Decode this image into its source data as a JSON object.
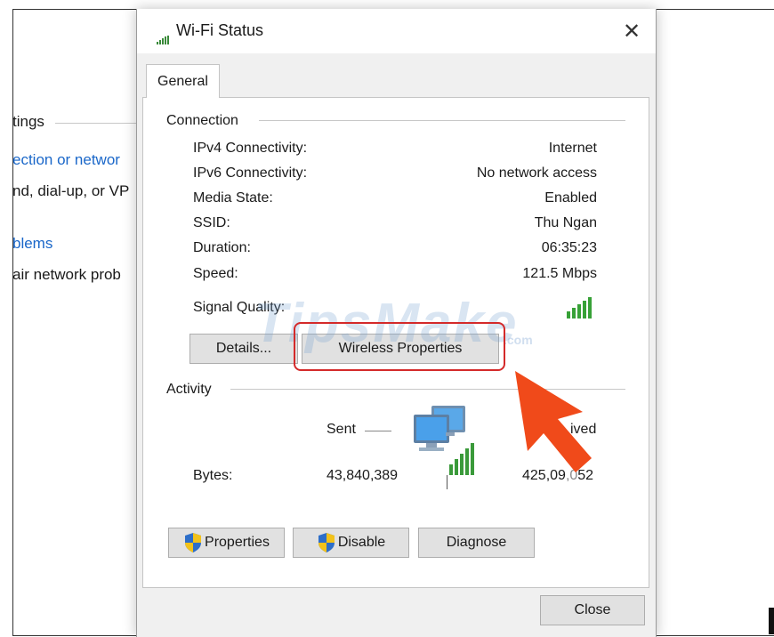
{
  "background": {
    "settings_fragment": "tings",
    "link_fragment": "ection or networ",
    "text_fragment": "nd, dial-up, or VP",
    "link2_fragment": "blems",
    "text2_fragment": "air network prob"
  },
  "dialog": {
    "title": "Wi-Fi Status",
    "close_glyph": "✕",
    "tab": "General",
    "connection": {
      "header": "Connection",
      "rows": [
        {
          "label": "IPv4 Connectivity:",
          "value": "Internet"
        },
        {
          "label": "IPv6 Connectivity:",
          "value": "No network access"
        },
        {
          "label": "Media State:",
          "value": "Enabled"
        },
        {
          "label": "SSID:",
          "value": "Thu Ngan"
        },
        {
          "label": "Duration:",
          "value": "06:35:23"
        },
        {
          "label": "Speed:",
          "value": "121.5 Mbps"
        }
      ],
      "signal_label": "Signal Quality:",
      "signal_bars": 5,
      "details_button": "Details...",
      "wireless_button": "Wireless Properties"
    },
    "activity": {
      "header": "Activity",
      "sent_label": "Sent",
      "received_label": "ived",
      "bytes_label": "Bytes:",
      "bytes_sent": "43,840,389",
      "bytes_received": "425,09",
      "bytes_received_tail": "52"
    },
    "buttons": {
      "properties": "Properties",
      "disable": "Disable",
      "diagnose": "Diagnose",
      "close": "Close"
    }
  },
  "overlay": {
    "watermark": "TipsMake",
    "watermark_suffix": ".com",
    "highlight_color": "#d42a2a",
    "arrow_color": "#f04a1a"
  },
  "icons": {
    "title": "wifi-signal-icon",
    "shield": "uac-shield-icon",
    "network": "network-computers-icon"
  }
}
